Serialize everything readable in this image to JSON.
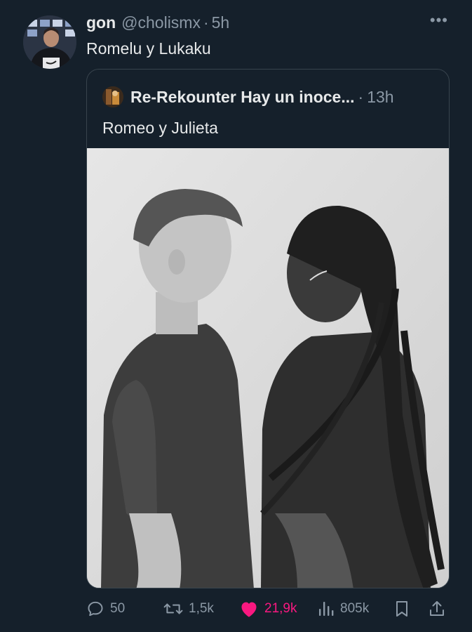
{
  "tweet": {
    "author_name": "gon",
    "author_handle": "@cholismx",
    "separator": "·",
    "time": "5h",
    "text": "Romelu y Lukaku",
    "more_label": "•••"
  },
  "quoted": {
    "author_name": "Re-Rekounter Hay un inoce...",
    "separator": "·",
    "time": "13h",
    "text": "Romeo y Julieta"
  },
  "actions": {
    "reply_count": "50",
    "retweet_count": "1,5k",
    "like_count": "21,9k",
    "views_count": "805k",
    "liked": true
  },
  "colors": {
    "background": "#15202b",
    "text_primary": "#e7e9ea",
    "text_secondary": "#8b98a5",
    "border": "#38444d",
    "like_accent": "#f91880"
  },
  "icons": {
    "reply": "speech-bubble-icon",
    "retweet": "retweet-icon",
    "like": "heart-icon",
    "views": "bar-chart-icon",
    "bookmark": "bookmark-icon",
    "share": "share-icon"
  }
}
